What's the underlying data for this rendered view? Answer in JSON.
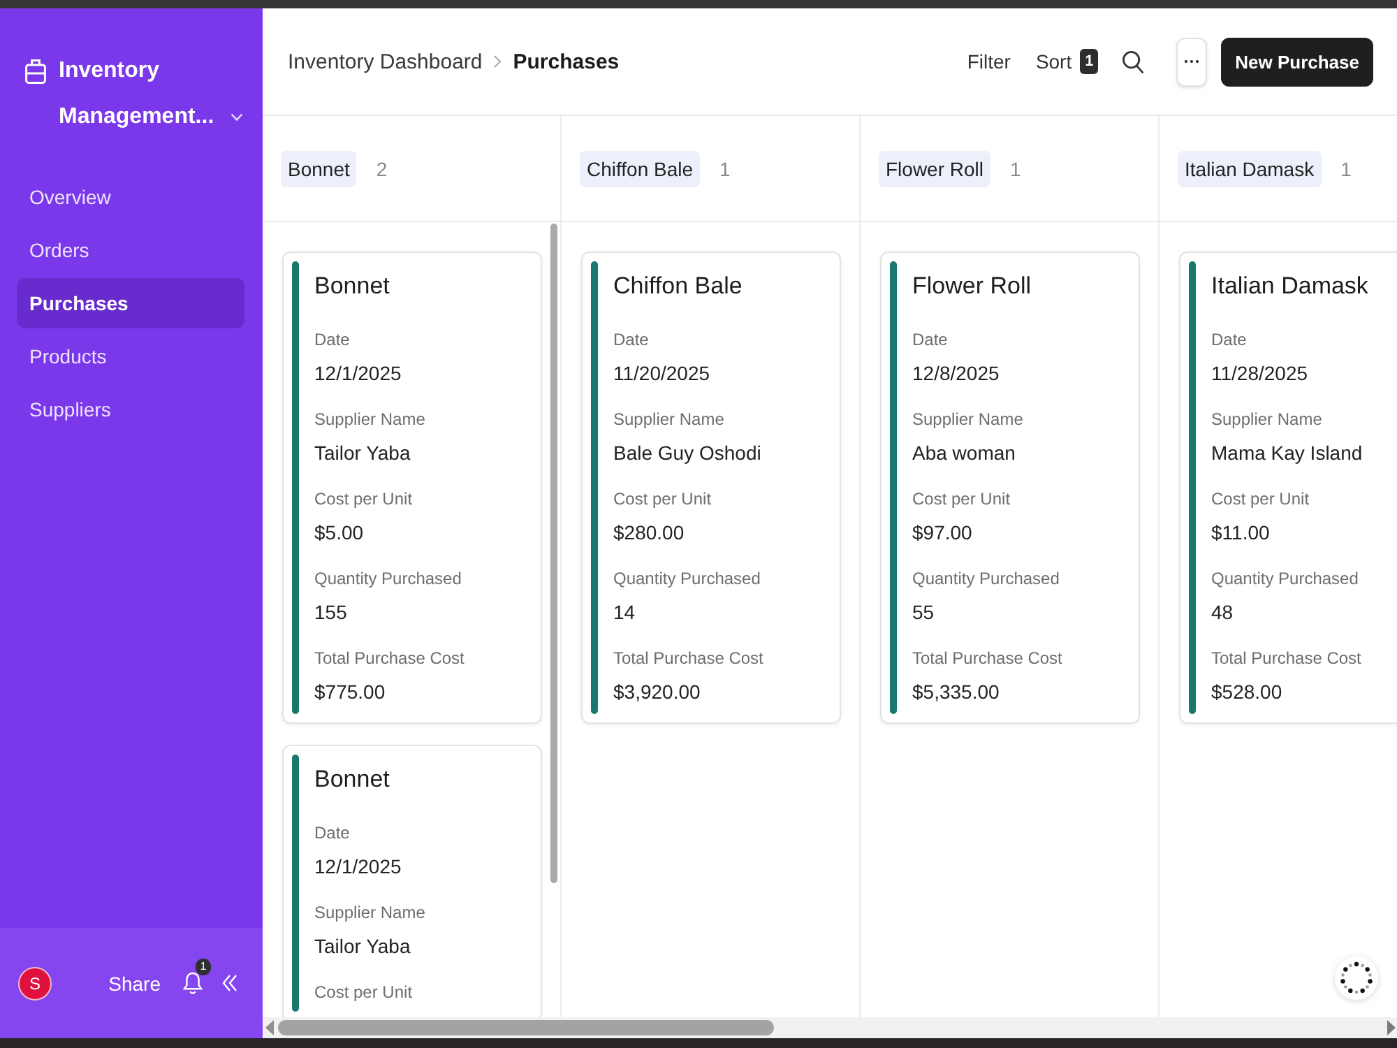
{
  "sidebar": {
    "title": "Inventory Management...",
    "items": [
      {
        "label": "Overview",
        "selected": false
      },
      {
        "label": "Orders",
        "selected": false
      },
      {
        "label": "Purchases",
        "selected": true
      },
      {
        "label": "Products",
        "selected": false
      },
      {
        "label": "Suppliers",
        "selected": false
      }
    ],
    "footer": {
      "avatar": "S",
      "share": "Share",
      "notification_count": "1"
    }
  },
  "header": {
    "breadcrumb": [
      "Inventory Dashboard",
      "Purchases"
    ],
    "filter": "Filter",
    "sort": "Sort",
    "sort_count": "1",
    "new_button": "New Purchase"
  },
  "board": {
    "columns": [
      {
        "name": "Bonnet",
        "count": "2",
        "cards": [
          {
            "title": "Bonnet",
            "fields": [
              {
                "label": "Date",
                "value": "12/1/2025"
              },
              {
                "label": "Supplier Name",
                "value": "Tailor Yaba"
              },
              {
                "label": "Cost per Unit",
                "value": "$5.00"
              },
              {
                "label": "Quantity Purchased",
                "value": "155"
              },
              {
                "label": "Total Purchase Cost",
                "value": "$775.00"
              }
            ]
          },
          {
            "title": "Bonnet",
            "fields": [
              {
                "label": "Date",
                "value": "12/1/2025"
              },
              {
                "label": "Supplier Name",
                "value": "Tailor Yaba"
              },
              {
                "label": "Cost per Unit"
              }
            ]
          }
        ]
      },
      {
        "name": "Chiffon Bale",
        "count": "1",
        "cards": [
          {
            "title": "Chiffon Bale",
            "fields": [
              {
                "label": "Date",
                "value": "11/20/2025"
              },
              {
                "label": "Supplier Name",
                "value": "Bale Guy Oshodi"
              },
              {
                "label": "Cost per Unit",
                "value": "$280.00"
              },
              {
                "label": "Quantity Purchased",
                "value": "14"
              },
              {
                "label": "Total Purchase Cost",
                "value": "$3,920.00"
              }
            ]
          }
        ]
      },
      {
        "name": "Flower Roll",
        "count": "1",
        "cards": [
          {
            "title": "Flower Roll",
            "fields": [
              {
                "label": "Date",
                "value": "12/8/2025"
              },
              {
                "label": "Supplier Name",
                "value": "Aba woman"
              },
              {
                "label": "Cost per Unit",
                "value": "$97.00"
              },
              {
                "label": "Quantity Purchased",
                "value": "55"
              },
              {
                "label": "Total Purchase Cost",
                "value": "$5,335.00"
              }
            ]
          }
        ]
      },
      {
        "name": "Italian Damask",
        "count": "1",
        "cards": [
          {
            "title": "Italian Damask",
            "fields": [
              {
                "label": "Date",
                "value": "11/28/2025"
              },
              {
                "label": "Supplier Name",
                "value": "Mama Kay Island"
              },
              {
                "label": "Cost per Unit",
                "value": "$11.00"
              },
              {
                "label": "Quantity Purchased",
                "value": "48"
              },
              {
                "label": "Total Purchase Cost",
                "value": "$528.00"
              }
            ]
          }
        ]
      }
    ]
  }
}
